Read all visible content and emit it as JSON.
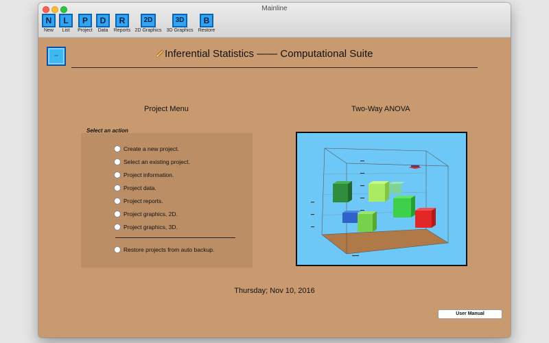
{
  "window": {
    "title": "Mainline"
  },
  "toolbar": [
    {
      "glyph": "N",
      "label": "New"
    },
    {
      "glyph": "L",
      "label": "List"
    },
    {
      "glyph": "P",
      "label": "Project"
    },
    {
      "glyph": "D",
      "label": "Data"
    },
    {
      "glyph": "R",
      "label": "Reports"
    },
    {
      "glyph": "2D",
      "label": "2D Graphics"
    },
    {
      "glyph": "3D",
      "label": "3D Graphics"
    },
    {
      "glyph": "B",
      "label": "Restore"
    }
  ],
  "header": {
    "title": "Inferential Statistics —— Computational Suite",
    "icon": "pencil-icon"
  },
  "project_menu": {
    "title": "Project Menu",
    "caption": "Select an action",
    "options": [
      "Create a new project.",
      "Select an existing project.",
      "Project information.",
      "Project data.",
      "Project reports.",
      "Project graphics, 2D.",
      "Project graphics, 3D.",
      "Restore projects from auto backup."
    ]
  },
  "anova": {
    "title": "Two-Way ANOVA"
  },
  "date": "Thursday; Nov 10, 2016",
  "footer": {
    "user_manual_label": "User Manual"
  },
  "colors": {
    "background": "#c99a70",
    "panel": "#bb8e66",
    "plot_background": "#6ec8f7",
    "plot_floor": "#b07a48",
    "toolbar_icon": "#35a4f0"
  }
}
